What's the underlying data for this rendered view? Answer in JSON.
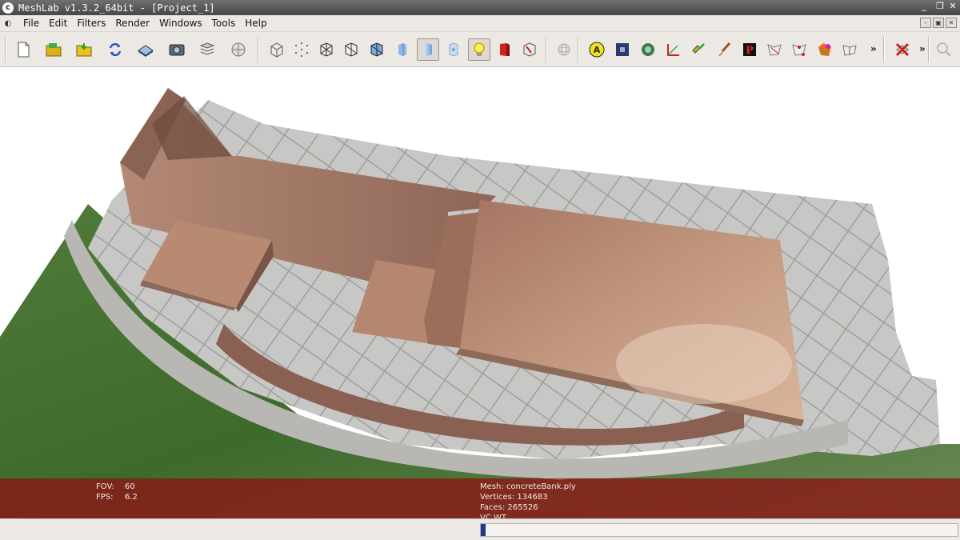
{
  "window": {
    "title": "MeshLab v1.3.2_64bit - [Project_1]",
    "logo_icon": "meshlab-logo-icon",
    "controls": [
      "_",
      "❐",
      "✕"
    ]
  },
  "menu": {
    "items": [
      {
        "label": "File"
      },
      {
        "label": "Edit"
      },
      {
        "label": "Filters"
      },
      {
        "label": "Render"
      },
      {
        "label": "Windows"
      },
      {
        "label": "Tools"
      },
      {
        "label": "Help"
      }
    ],
    "mdi_controls": [
      "–",
      "▣",
      "✕"
    ]
  },
  "toolbar": {
    "buttons": [
      {
        "name": "new-project-icon"
      },
      {
        "name": "open-project-icon"
      },
      {
        "name": "import-mesh-icon"
      },
      {
        "name": "reload-icon"
      },
      {
        "name": "export-mesh-icon"
      },
      {
        "name": "snapshot-icon"
      },
      {
        "name": "layers-icon"
      },
      {
        "name": "raster-globe-icon"
      },
      {
        "name": "bbox-icon"
      },
      {
        "name": "points-icon"
      },
      {
        "name": "wireframe-icon"
      },
      {
        "name": "hidden-lines-icon"
      },
      {
        "name": "flat-lines-icon"
      },
      {
        "name": "flat-icon"
      },
      {
        "name": "smooth-icon"
      },
      {
        "name": "texture-icon"
      },
      {
        "name": "light-icon"
      },
      {
        "name": "double-side-light-icon"
      },
      {
        "name": "backface-culling-icon"
      },
      {
        "name": "trackball-icon"
      },
      {
        "name": "annotation-icon"
      },
      {
        "name": "pick-raster-icon"
      },
      {
        "name": "paint-texture-icon"
      },
      {
        "name": "measure-icon"
      },
      {
        "name": "align-icon"
      },
      {
        "name": "paint-brush-icon"
      },
      {
        "name": "point-picker-icon"
      },
      {
        "name": "select-faces-icon"
      },
      {
        "name": "select-vertices-icon"
      },
      {
        "name": "select-connected-icon"
      },
      {
        "name": "manipulator-icon"
      },
      {
        "name": "delete-selection-icon"
      },
      {
        "name": "search-icon"
      }
    ],
    "more": "»"
  },
  "info": {
    "fov_label": "FOV:",
    "fov_value": "60",
    "fps_label": "FPS:",
    "fps_value": "6.2",
    "mesh": "Mesh: concreteBank.ply",
    "vertices": "Vertices: 134683",
    "faces": "Faces: 265526",
    "vc": "VC WT"
  },
  "status": {
    "progress_fraction": 0.01
  }
}
